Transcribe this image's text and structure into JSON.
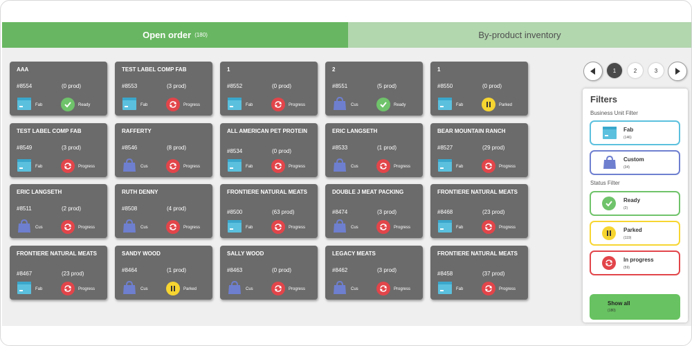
{
  "tabs": [
    {
      "label": "Open order",
      "count": "(180)"
    },
    {
      "label": "By-product inventory"
    }
  ],
  "cards": [
    {
      "title": "aaa",
      "id": "#8554",
      "prod": "(0 prod)",
      "bu": "Fab",
      "status": "Ready"
    },
    {
      "title": "TEST LABEL COMP FAB",
      "id": "#8553",
      "prod": "(3 prod)",
      "bu": "Fab",
      "status": "Progress"
    },
    {
      "title": "1",
      "id": "#8552",
      "prod": "(0 prod)",
      "bu": "Fab",
      "status": "Progress"
    },
    {
      "title": "2",
      "id": "#8551",
      "prod": "(5 prod)",
      "bu": "Cus",
      "status": "Ready"
    },
    {
      "title": "1",
      "id": "#8550",
      "prod": "(0 prod)",
      "bu": "Fab",
      "status": "Parked"
    },
    {
      "title": "TEST LABEL COMP FAB",
      "id": "#8549",
      "prod": "(3 prod)",
      "bu": "Fab",
      "status": "Progress"
    },
    {
      "title": "RAFFERTY",
      "id": "#8546",
      "prod": "(8 prod)",
      "bu": "Cus",
      "status": "Progress"
    },
    {
      "title": "ALL AMERICAN PET PROTEIN",
      "id": "#8534",
      "prod": "(0 prod)",
      "bu": "Fab",
      "status": "Progress"
    },
    {
      "title": "ERIC LANGSETH",
      "id": "#8533",
      "prod": "(1 prod)",
      "bu": "Cus",
      "status": "Progress"
    },
    {
      "title": "BEAR MOUNTAIN RANCH",
      "id": "#8527",
      "prod": "(29 prod)",
      "bu": "Fab",
      "status": "Progress"
    },
    {
      "title": "ERIC LANGSETH",
      "id": "#8511",
      "prod": "(2 prod)",
      "bu": "Cus",
      "status": "Progress"
    },
    {
      "title": "RUTH DENNY",
      "id": "#8508",
      "prod": "(4 prod)",
      "bu": "Cus",
      "status": "Progress"
    },
    {
      "title": "FRONTIERE NATURAL MEATS",
      "id": "#8500",
      "prod": "(63 prod)",
      "bu": "Fab",
      "status": "Progress"
    },
    {
      "title": "DOUBLE J MEAT PACKING",
      "id": "#8474",
      "prod": "(3 prod)",
      "bu": "Cus",
      "status": "Progress"
    },
    {
      "title": "FRONTIERE NATURAL MEATS",
      "id": "#8468",
      "prod": "(23 prod)",
      "bu": "Fab",
      "status": "Progress"
    },
    {
      "title": "FRONTIERE NATURAL MEATS",
      "id": "#8467",
      "prod": "(23 prod)",
      "bu": "Fab",
      "status": "Progress"
    },
    {
      "title": "SANDY WOOD",
      "id": "#8464",
      "prod": "(1 prod)",
      "bu": "Cus",
      "status": "Parked"
    },
    {
      "title": "SALLY WOOD",
      "id": "#8463",
      "prod": "(0 prod)",
      "bu": "Cus",
      "status": "Progress"
    },
    {
      "title": "LEGACY MEATS",
      "id": "#8462",
      "prod": "(3 prod)",
      "bu": "Cus",
      "status": "Progress"
    },
    {
      "title": "FRONTIERE NATURAL MEATS",
      "id": "#8458",
      "prod": "(37 prod)",
      "bu": "Fab",
      "status": "Progress"
    }
  ],
  "pagination": {
    "pages": [
      "1",
      "2",
      "3"
    ],
    "current": "1",
    "prev_icon": "chevron-left-icon",
    "next_icon": "chevron-right-icon"
  },
  "filters": {
    "title": "Filters",
    "business_unit_label": "Business Unit Filter",
    "business_units": [
      {
        "label": "Fab",
        "count": "(146)",
        "color": "#5bc0de",
        "icon": "box-icon"
      },
      {
        "label": "Custom",
        "count": "(34)",
        "color": "#6e7fd0",
        "icon": "bag-icon"
      }
    ],
    "status_label": "Status Filter",
    "statuses": [
      {
        "label": "Ready",
        "count": "(2)",
        "color": "#6fc36a",
        "icon": "check-icon"
      },
      {
        "label": "Parked",
        "count": "(119)",
        "color": "#f7d531",
        "icon": "pause-icon"
      },
      {
        "label": "In progress",
        "count": "(59)",
        "color": "#e2454a",
        "icon": "refresh-icon"
      }
    ],
    "show_all": {
      "label": "Show all",
      "count": "(180)"
    }
  },
  "colors": {
    "accent": "#68b661",
    "card_bg": "#6b6b6b",
    "fab": "#5bc0de",
    "custom": "#6e7fd0",
    "ready": "#6fc36a",
    "parked": "#f7d531",
    "progress": "#e2454a"
  }
}
